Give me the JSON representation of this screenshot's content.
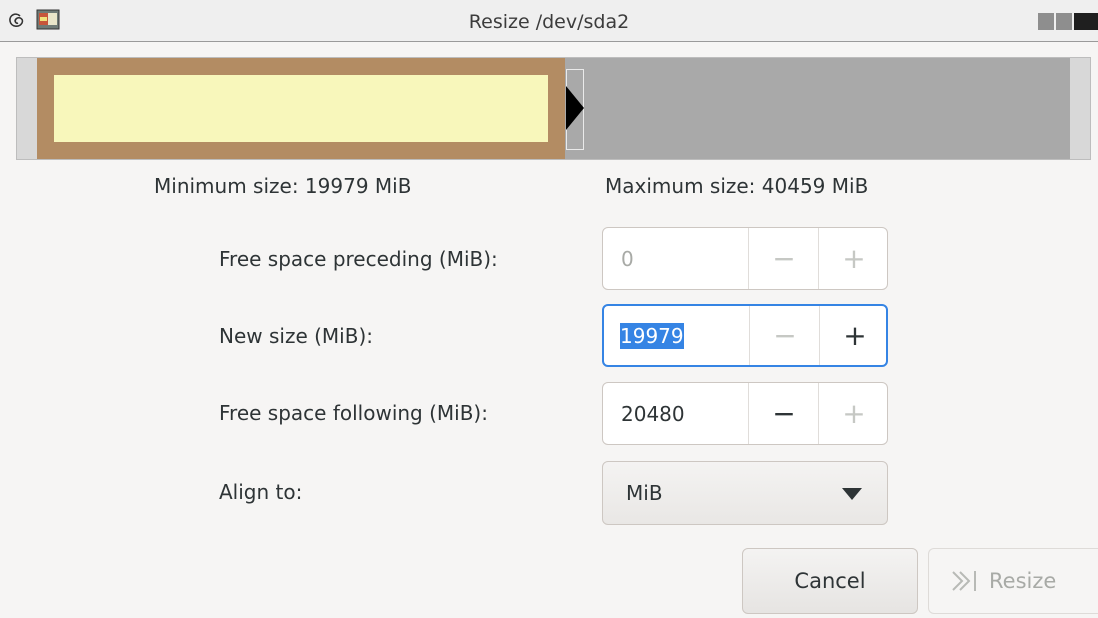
{
  "window": {
    "title": "Resize /dev/sda2"
  },
  "partition_bar": {
    "used_fraction": 0.494,
    "colors": {
      "track": "#a9a9a9",
      "border": "#b38c63",
      "fill": "#f8f7bb"
    }
  },
  "limits": {
    "min_label": "Minimum size: 19979 MiB",
    "max_label": "Maximum size: 40459 MiB"
  },
  "form": {
    "preceding": {
      "label": "Free space preceding (MiB):",
      "value": "0"
    },
    "new_size": {
      "label": "New size (MiB):",
      "value": "19979"
    },
    "following": {
      "label": "Free space following (MiB):",
      "value": "20480"
    },
    "align": {
      "label": "Align to:",
      "value": "MiB"
    },
    "minus_glyph": "−",
    "plus_glyph": "+"
  },
  "buttons": {
    "cancel": "Cancel",
    "resize": "Resize"
  },
  "accent_color": "#3584e4"
}
